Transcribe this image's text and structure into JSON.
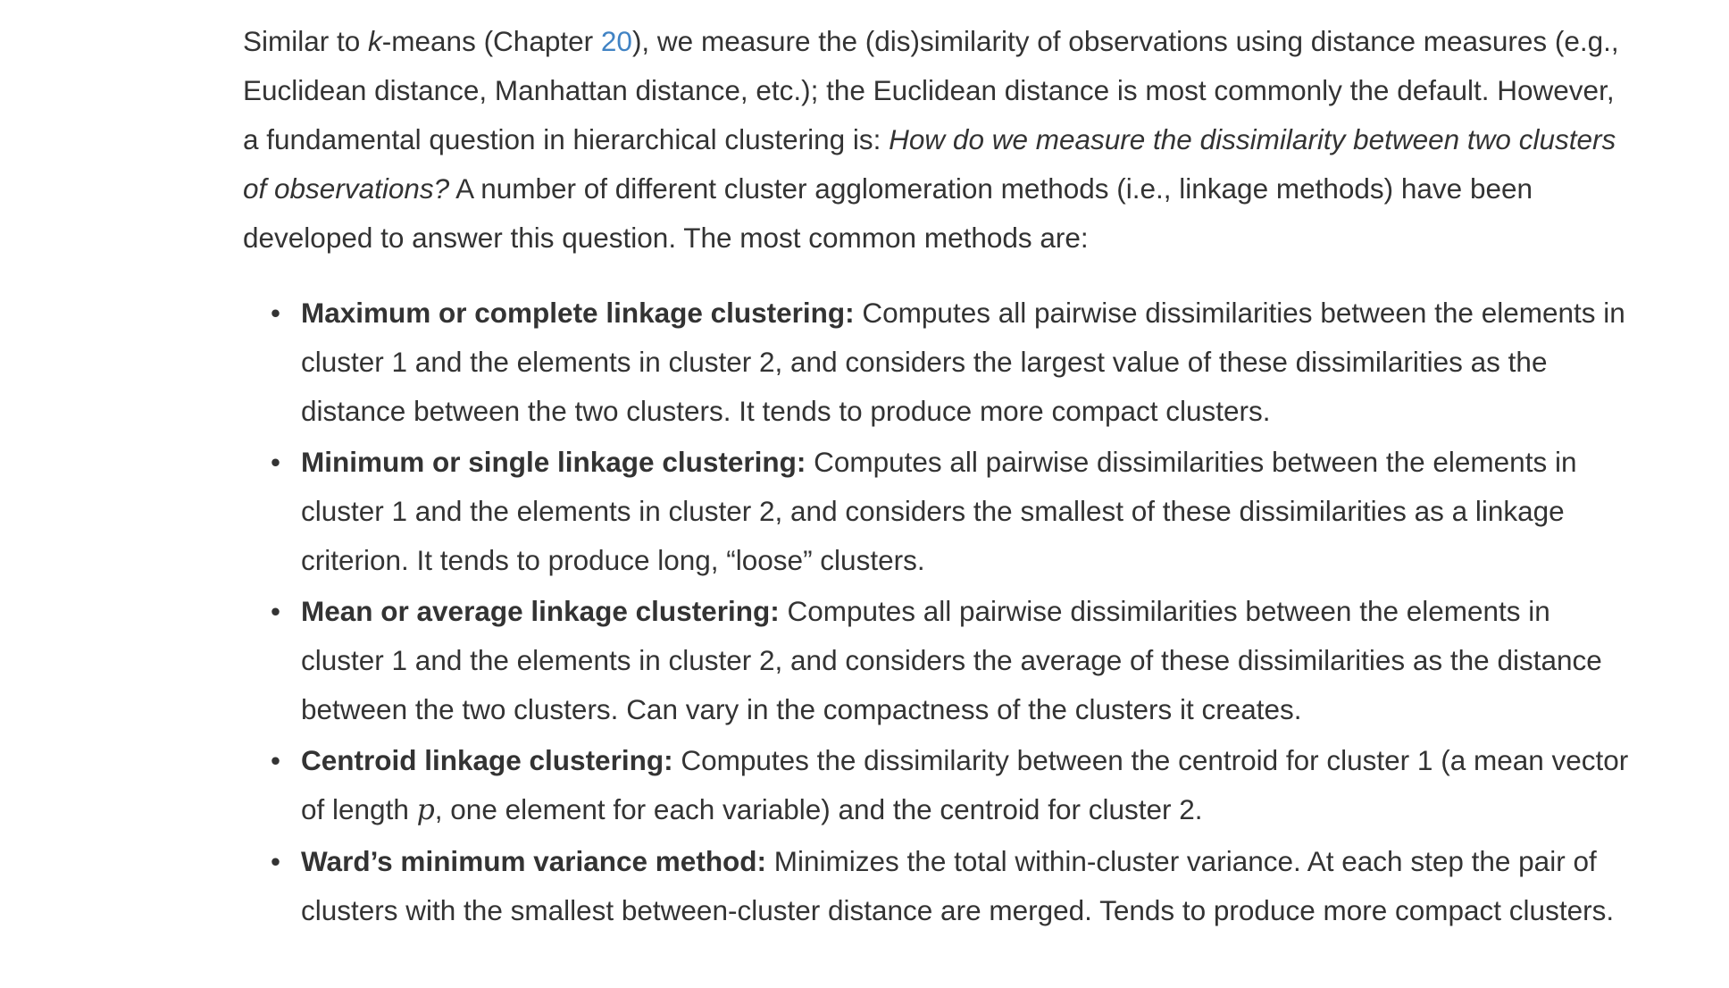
{
  "intro": {
    "p1": "Similar to ",
    "k": "k",
    "p2": "-means (Chapter ",
    "chapter_link": "20",
    "p3": "), we measure the (dis)similarity of observations using distance measures (e.g., Euclidean distance, Manhattan distance, etc.); the Euclidean distance is most commonly the default. However, a fundamental question in hierarchical clustering is: ",
    "question": "How do we measure the dissimilarity between two clusters of observations?",
    "p4": " A number of different cluster agglomeration methods (i.e., linkage methods) have been developed to answer this question. The most common methods are:"
  },
  "bullet_glyph": "•",
  "methods": [
    {
      "term": "Maximum or complete linkage clustering:",
      "text": " Computes all pairwise dissimilarities between the elements in cluster 1 and the elements in cluster 2, and considers the largest value of these dissimilarities as the distance between the two clusters. It tends to produce more compact clusters."
    },
    {
      "term": "Minimum or single linkage clustering:",
      "text": " Computes all pairwise dissimilarities between the elements in cluster 1 and the elements in cluster 2, and considers the smallest of these dissimilarities as a linkage criterion. It tends to produce long, “loose” clusters."
    },
    {
      "term": "Mean or average linkage clustering:",
      "text": " Computes all pairwise dissimilarities between the elements in cluster 1 and the elements in cluster 2, and considers the average of these dissimilarities as the distance between the two clusters. Can vary in the compactness of the clusters it creates."
    },
    {
      "term": "Centroid linkage clustering:",
      "text_a": " Computes the dissimilarity between the centroid for cluster 1 (a mean vector of length ",
      "math": "p",
      "text_b": ", one element for each variable) and the centroid for cluster 2."
    },
    {
      "term": "Ward’s minimum variance method:",
      "text": " Minimizes the total within-cluster variance. At each step the pair of clusters with the smallest between-cluster distance are merged. Tends to produce more compact clusters."
    }
  ]
}
